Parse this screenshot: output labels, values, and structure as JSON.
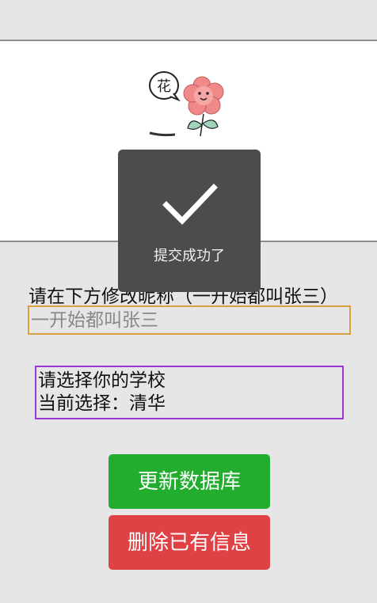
{
  "form": {
    "nickname_label": "请在下方修改昵称（一开始都叫张三）",
    "nickname_placeholder": "一开始都叫张三"
  },
  "school": {
    "prompt": "请选择你的学校",
    "current_prefix": "当前选择：",
    "current_value": "清华"
  },
  "buttons": {
    "update_label": "更新数据库",
    "delete_label": "删除已有信息"
  },
  "toast": {
    "message": "提交成功了",
    "icon": "checkmark-icon"
  },
  "avatar": {
    "text": "花"
  },
  "colors": {
    "background": "#e6e6e6",
    "input_border": "#d8a13a",
    "school_border": "#9a38d8",
    "update_button": "#22ad2e",
    "delete_button": "#e04145",
    "toast_background": "#4c4c4c"
  }
}
